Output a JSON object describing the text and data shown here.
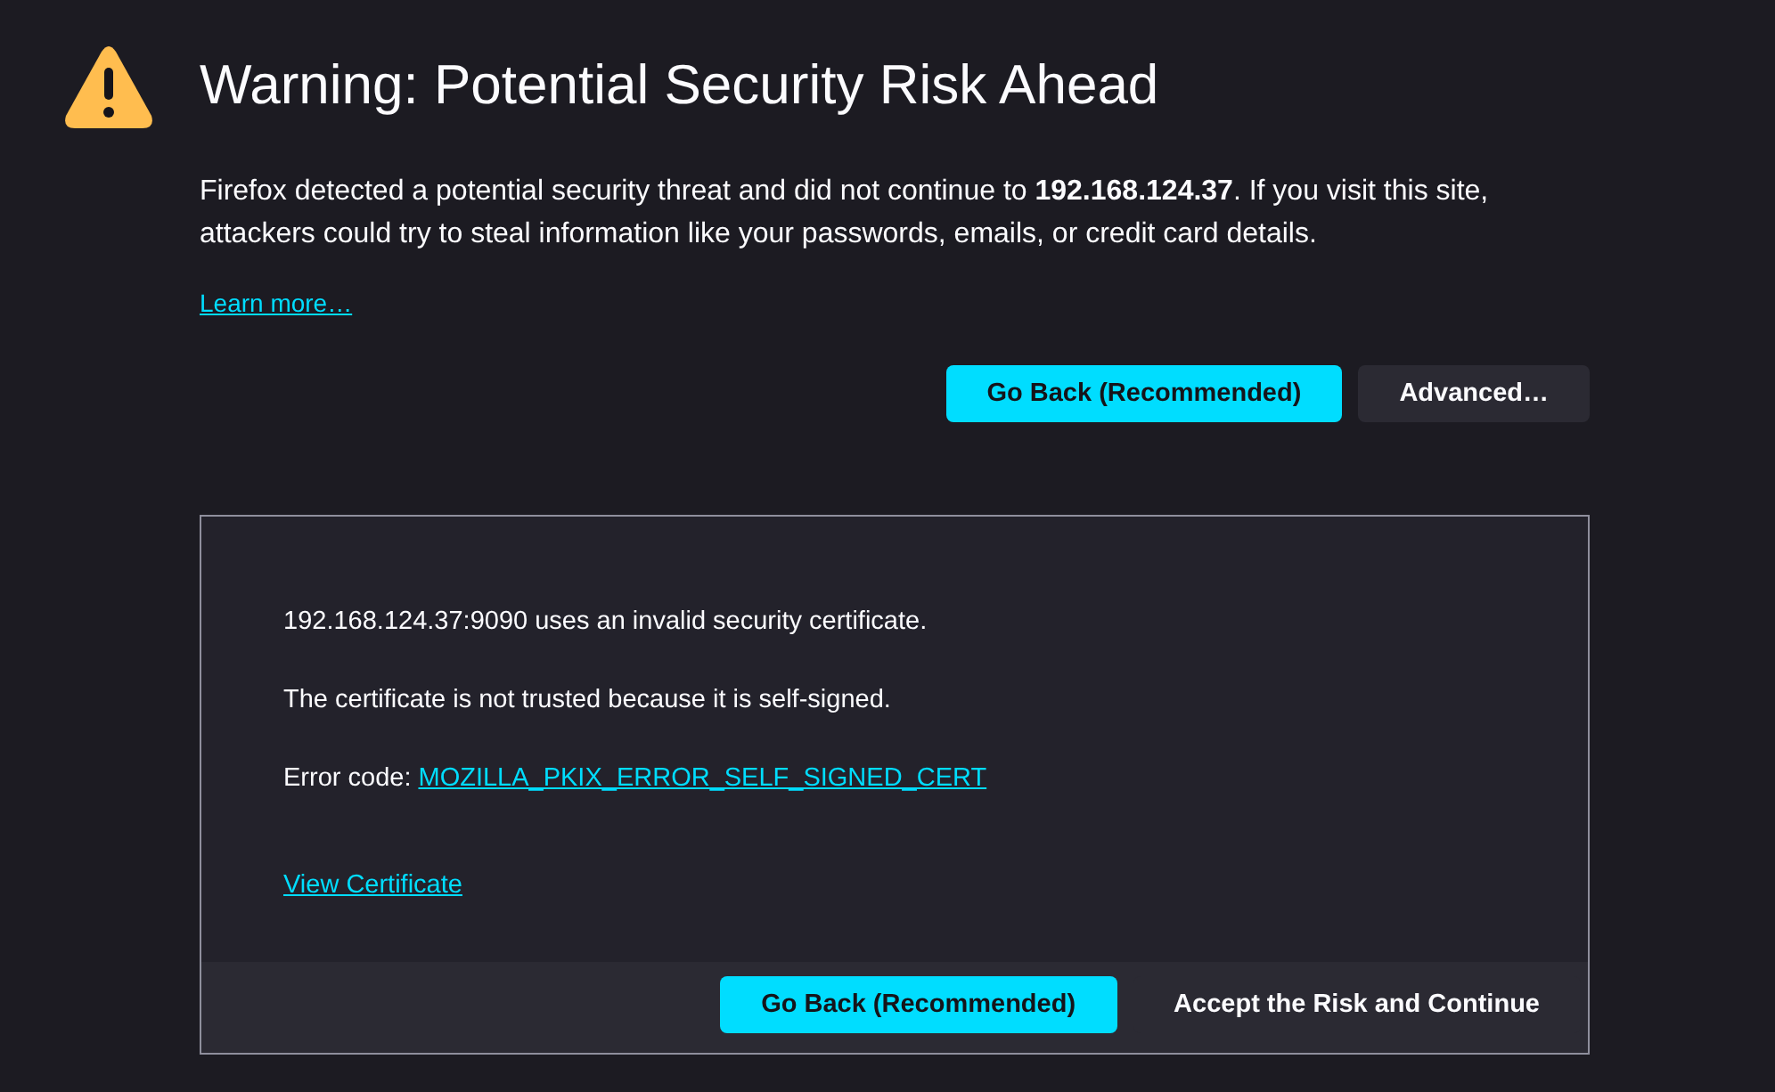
{
  "title": "Warning: Potential Security Risk Ahead",
  "intro": "Firefox detected a potential security threat and did not continue to **192.168.124.37**. If you visit this site, attackers could try to steal information like your passwords, emails, or credit card details.",
  "learn_more": "Learn more…",
  "buttons": [
    {
      "label": "Go Back (Recommended)",
      "kind": "primary"
    },
    {
      "label": "Advanced…",
      "kind": "secondary"
    }
  ],
  "advanced": {
    "lines": [
      "192.168.124.37:9090 uses an invalid security certificate.",
      "The certificate is not trusted because it is self-signed."
    ],
    "error_label": "Error code:",
    "error_code": "MOZILLA_PKIX_ERROR_SELF_SIGNED_CERT",
    "view_certificate": "View Certificate",
    "buttons": [
      {
        "label": "Go Back (Recommended)",
        "kind": "primary"
      },
      {
        "label": "Accept the Risk and Continue",
        "kind": "secondary"
      }
    ]
  }
}
